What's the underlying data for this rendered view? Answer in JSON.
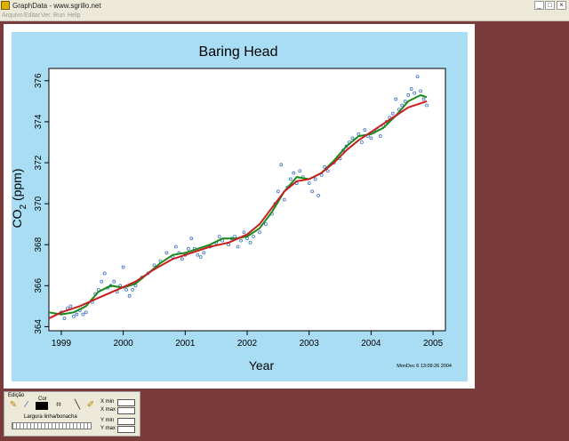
{
  "window": {
    "title": "GraphData - www.sgrillo.net",
    "buttons": [
      "_",
      "□",
      "×"
    ],
    "menu": [
      "Arquivo",
      "Editar",
      "Ver",
      "Run",
      "Help"
    ]
  },
  "palette": {
    "edit_label": "Edição",
    "color_label": "Cor",
    "width_label": "Largura linha/bonacha",
    "xmin_label": "X min",
    "xmax_label": "X max",
    "ymin_label": "Y min",
    "ymax_label": "Y max",
    "tools": [
      "pencil-icon",
      "brush-icon",
      "color-swatch-icon",
      "crop-icon",
      "line-icon",
      "pen-icon"
    ]
  },
  "chart_data": {
    "type": "scatter",
    "title": "Baring Head",
    "xlabel": "Year",
    "ylabel_main": "CO",
    "ylabel_sub": "2",
    "ylabel_unit": " (ppm)",
    "footnote": "MonDec  6 13:09:26 2004",
    "xlim": [
      1998.8,
      2005.2
    ],
    "ylim": [
      363.8,
      376.6
    ],
    "xticks": [
      1999,
      2000,
      2001,
      2002,
      2003,
      2004,
      2005
    ],
    "yticks": [
      364,
      366,
      368,
      370,
      372,
      374,
      376
    ],
    "series": [
      {
        "kind": "points",
        "color": "#3a70c0",
        "points": [
          [
            1999.0,
            364.7
          ],
          [
            1999.05,
            364.4
          ],
          [
            1999.1,
            364.9
          ],
          [
            1999.15,
            365.0
          ],
          [
            1999.2,
            364.5
          ],
          [
            1999.25,
            364.6
          ],
          [
            1999.3,
            364.8
          ],
          [
            1999.35,
            364.6
          ],
          [
            1999.4,
            364.7
          ],
          [
            1999.5,
            365.2
          ],
          [
            1999.55,
            365.6
          ],
          [
            1999.6,
            365.8
          ],
          [
            1999.65,
            366.2
          ],
          [
            1999.7,
            366.6
          ],
          [
            1999.75,
            365.9
          ],
          [
            1999.8,
            366.0
          ],
          [
            1999.85,
            366.2
          ],
          [
            1999.9,
            365.7
          ],
          [
            1999.95,
            366.0
          ],
          [
            2000.0,
            366.9
          ],
          [
            2000.05,
            365.8
          ],
          [
            2000.1,
            365.5
          ],
          [
            2000.15,
            365.8
          ],
          [
            2000.2,
            366.0
          ],
          [
            2000.3,
            366.4
          ],
          [
            2000.4,
            366.6
          ],
          [
            2000.5,
            367.0
          ],
          [
            2000.6,
            367.2
          ],
          [
            2000.7,
            367.6
          ],
          [
            2000.8,
            367.4
          ],
          [
            2000.85,
            367.9
          ],
          [
            2000.9,
            367.6
          ],
          [
            2000.95,
            367.3
          ],
          [
            2001.0,
            367.5
          ],
          [
            2001.05,
            367.8
          ],
          [
            2001.1,
            368.3
          ],
          [
            2001.15,
            367.8
          ],
          [
            2001.2,
            367.5
          ],
          [
            2001.25,
            367.4
          ],
          [
            2001.3,
            367.6
          ],
          [
            2001.4,
            367.9
          ],
          [
            2001.5,
            368.1
          ],
          [
            2001.55,
            368.4
          ],
          [
            2001.6,
            368.2
          ],
          [
            2001.7,
            368.0
          ],
          [
            2001.75,
            368.3
          ],
          [
            2001.8,
            368.4
          ],
          [
            2001.85,
            367.9
          ],
          [
            2001.9,
            368.2
          ],
          [
            2001.95,
            368.6
          ],
          [
            2002.0,
            368.3
          ],
          [
            2002.05,
            368.1
          ],
          [
            2002.1,
            368.4
          ],
          [
            2002.2,
            368.6
          ],
          [
            2002.3,
            369.0
          ],
          [
            2002.4,
            369.5
          ],
          [
            2002.45,
            370.0
          ],
          [
            2002.5,
            370.6
          ],
          [
            2002.55,
            371.9
          ],
          [
            2002.6,
            370.2
          ],
          [
            2002.65,
            370.8
          ],
          [
            2002.7,
            371.2
          ],
          [
            2002.75,
            371.5
          ],
          [
            2002.8,
            371.0
          ],
          [
            2002.85,
            371.6
          ],
          [
            2002.9,
            371.3
          ],
          [
            2003.0,
            371.0
          ],
          [
            2003.05,
            370.6
          ],
          [
            2003.1,
            371.2
          ],
          [
            2003.15,
            370.4
          ],
          [
            2003.2,
            371.4
          ],
          [
            2003.25,
            371.8
          ],
          [
            2003.3,
            371.6
          ],
          [
            2003.4,
            372.0
          ],
          [
            2003.5,
            372.2
          ],
          [
            2003.55,
            372.6
          ],
          [
            2003.6,
            372.8
          ],
          [
            2003.65,
            373.0
          ],
          [
            2003.7,
            373.2
          ],
          [
            2003.8,
            373.4
          ],
          [
            2003.85,
            373.0
          ],
          [
            2003.9,
            373.6
          ],
          [
            2003.95,
            373.3
          ],
          [
            2004.0,
            373.2
          ],
          [
            2004.05,
            373.5
          ],
          [
            2004.1,
            373.6
          ],
          [
            2004.15,
            373.3
          ],
          [
            2004.2,
            373.8
          ],
          [
            2004.25,
            374.0
          ],
          [
            2004.3,
            374.2
          ],
          [
            2004.35,
            374.4
          ],
          [
            2004.4,
            375.1
          ],
          [
            2004.45,
            374.6
          ],
          [
            2004.5,
            374.8
          ],
          [
            2004.55,
            375.0
          ],
          [
            2004.6,
            375.3
          ],
          [
            2004.65,
            375.6
          ],
          [
            2004.7,
            375.4
          ],
          [
            2004.75,
            376.2
          ],
          [
            2004.8,
            375.5
          ],
          [
            2004.85,
            375.1
          ],
          [
            2004.9,
            374.8
          ]
        ]
      },
      {
        "kind": "line",
        "color": "#1a8a1a",
        "points": [
          [
            1998.8,
            364.7
          ],
          [
            1999.0,
            364.6
          ],
          [
            1999.2,
            364.7
          ],
          [
            1999.4,
            365.0
          ],
          [
            1999.6,
            365.7
          ],
          [
            1999.8,
            366.0
          ],
          [
            2000.0,
            365.9
          ],
          [
            2000.2,
            366.1
          ],
          [
            2000.4,
            366.6
          ],
          [
            2000.6,
            367.1
          ],
          [
            2000.8,
            367.5
          ],
          [
            2001.0,
            367.6
          ],
          [
            2001.2,
            367.8
          ],
          [
            2001.4,
            368.0
          ],
          [
            2001.6,
            368.3
          ],
          [
            2001.8,
            368.3
          ],
          [
            2002.0,
            368.4
          ],
          [
            2002.2,
            368.8
          ],
          [
            2002.4,
            369.6
          ],
          [
            2002.6,
            370.6
          ],
          [
            2002.8,
            371.3
          ],
          [
            2003.0,
            371.2
          ],
          [
            2003.2,
            371.5
          ],
          [
            2003.4,
            372.1
          ],
          [
            2003.6,
            372.8
          ],
          [
            2003.8,
            373.3
          ],
          [
            2004.0,
            373.4
          ],
          [
            2004.2,
            373.7
          ],
          [
            2004.4,
            374.3
          ],
          [
            2004.6,
            375.0
          ],
          [
            2004.8,
            375.3
          ],
          [
            2004.9,
            375.2
          ]
        ]
      },
      {
        "kind": "line",
        "color": "#c81e1e",
        "points": [
          [
            1998.8,
            364.4
          ],
          [
            1999.0,
            364.7
          ],
          [
            1999.3,
            365.0
          ],
          [
            1999.6,
            365.4
          ],
          [
            1999.9,
            365.8
          ],
          [
            2000.2,
            366.2
          ],
          [
            2000.5,
            366.8
          ],
          [
            2000.8,
            367.3
          ],
          [
            2001.1,
            367.6
          ],
          [
            2001.4,
            367.9
          ],
          [
            2001.7,
            368.1
          ],
          [
            2002.0,
            368.5
          ],
          [
            2002.2,
            369.0
          ],
          [
            2002.4,
            369.8
          ],
          [
            2002.6,
            370.6
          ],
          [
            2002.8,
            371.1
          ],
          [
            2003.0,
            371.2
          ],
          [
            2003.2,
            371.5
          ],
          [
            2003.4,
            372.0
          ],
          [
            2003.6,
            372.6
          ],
          [
            2003.8,
            373.1
          ],
          [
            2004.0,
            373.5
          ],
          [
            2004.2,
            373.9
          ],
          [
            2004.4,
            374.3
          ],
          [
            2004.6,
            374.7
          ],
          [
            2004.9,
            375.0
          ]
        ]
      }
    ]
  }
}
